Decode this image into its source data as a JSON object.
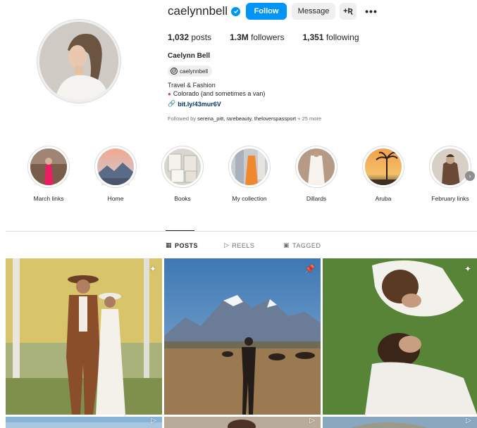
{
  "profile": {
    "username": "caelynnbell",
    "follow_label": "Follow",
    "message_label": "Message",
    "add_user_label": "+Ʀ",
    "more_label": "•••",
    "posts_count": "1,032",
    "posts_label": "posts",
    "followers_count": "1.3M",
    "followers_label": "followers",
    "following_count": "1,351",
    "following_label": "following",
    "full_name": "Caelynn Bell",
    "threads_handle": "caelynnbell",
    "bio_line1": "Travel & Fashion",
    "bio_line2": "Colorado (and sometimes a van)",
    "link": "bit.ly/43mur6V",
    "followed_by_prefix": "Followed by",
    "followed_by_names": "serena_pitt, rarebeauty, theloverspassport",
    "followed_by_more": "+ 25 more"
  },
  "highlights": [
    {
      "label": "March links"
    },
    {
      "label": "Home"
    },
    {
      "label": "Books"
    },
    {
      "label": "My collection"
    },
    {
      "label": "Dillards"
    },
    {
      "label": "Aruba"
    },
    {
      "label": "February links"
    }
  ],
  "tabs": {
    "posts": "POSTS",
    "reels": "REELS",
    "tagged": "TAGGED"
  },
  "icons": {
    "verified": "verified-badge-icon",
    "threads": "threads-icon",
    "pin": "location-pin-icon",
    "link": "link-icon",
    "grid": "grid-icon",
    "reels": "reels-icon",
    "tagged": "tagged-icon",
    "pinned": "pinned-post-icon",
    "next": "chevron-right-icon"
  },
  "colors": {
    "accent": "#0095f6",
    "link": "#00376b",
    "muted": "#737373"
  }
}
